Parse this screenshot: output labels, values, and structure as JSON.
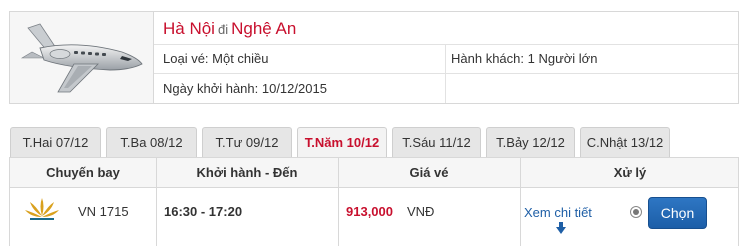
{
  "route": {
    "from": "Hà Nội",
    "connector": "đi",
    "to": "Nghệ An"
  },
  "ticket_type": "Loại vé: Một chiều",
  "passengers": "Hành khách: 1 Người lớn",
  "departure_date": "Ngày khởi hành: 10/12/2015",
  "tabs": [
    {
      "label": "T.Hai 07/12",
      "active": false
    },
    {
      "label": "T.Ba 08/12",
      "active": false
    },
    {
      "label": "T.Tư 09/12",
      "active": false
    },
    {
      "label": "T.Năm 10/12",
      "active": true
    },
    {
      "label": "T.Sáu 11/12",
      "active": false
    },
    {
      "label": "T.Bảy 12/12",
      "active": false
    },
    {
      "label": "C.Nhật 13/12",
      "active": false
    }
  ],
  "table": {
    "headers": [
      "Chuyến bay",
      "Khởi hành - Đến",
      "Giá vé",
      "Xử lý"
    ],
    "rows": [
      {
        "flight_no": "VN 1715",
        "times": "16:30 - 17:20",
        "price": "913,000",
        "currency": "VNĐ",
        "detail_link": "Xem chi tiết",
        "select_label": "Chọn",
        "airline_logo": "lotus-logo-icon"
      }
    ]
  },
  "colors": {
    "accent_red": "#c8102e",
    "button_blue": "#2e76c3",
    "link_blue": "#1f5fa6",
    "logo_gold": "#d9a11e"
  }
}
